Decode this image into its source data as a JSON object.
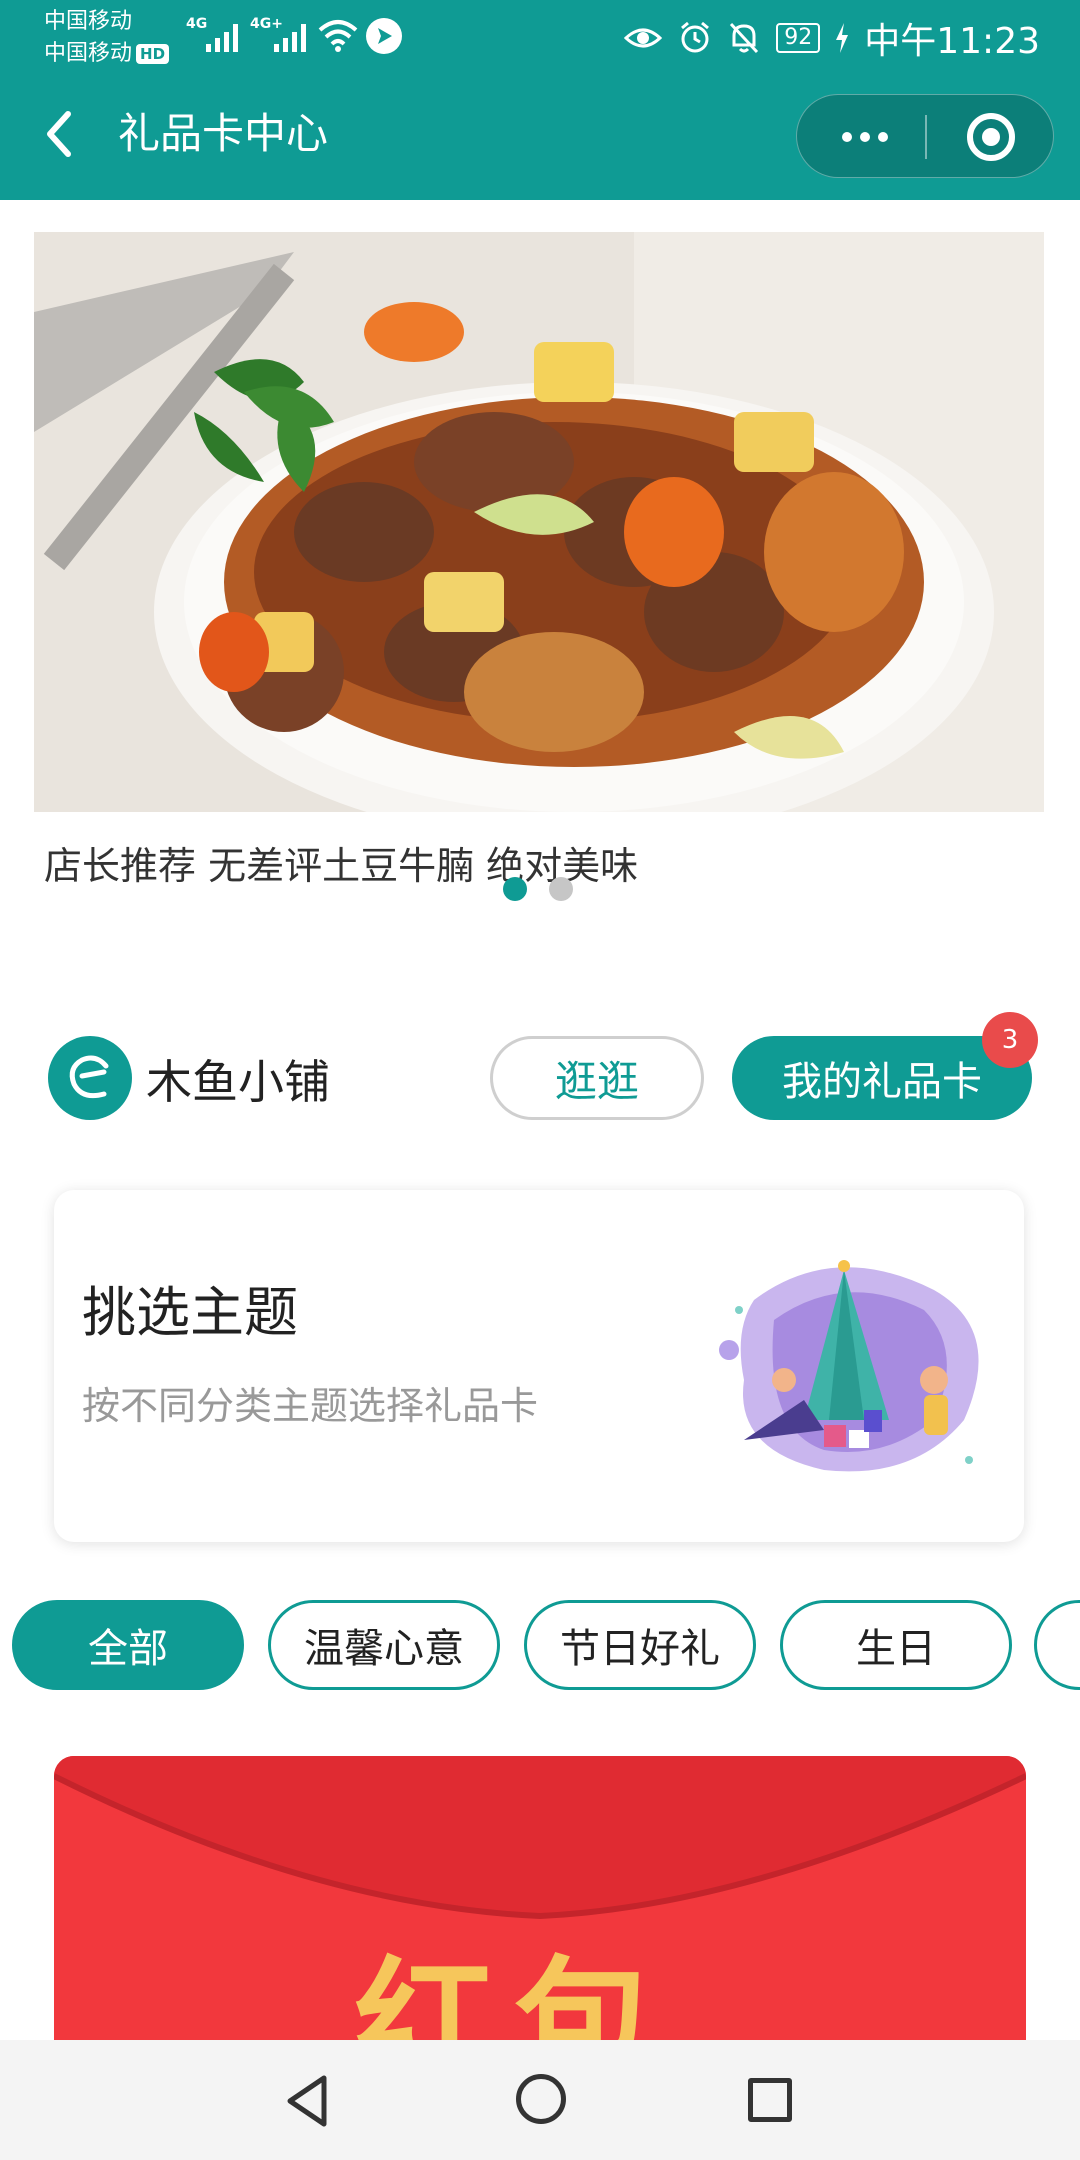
{
  "status_bar": {
    "carrier_1": "中国移动",
    "carrier_2": "中国移动",
    "hd": "HD",
    "signal_1": "4G",
    "signal_2": "4G+",
    "battery": "92",
    "time": "中午11:23"
  },
  "nav": {
    "back_icon": "chevron-left-icon",
    "title": "礼品卡中心",
    "more_icon": "more-dots-icon",
    "close_icon": "target-icon"
  },
  "banner": {
    "caption": "店长推荐 无差评土豆牛腩 绝对美味",
    "slides": 2,
    "active_slide": 1
  },
  "shop": {
    "name": "木鱼小铺",
    "browse_label": "逛逛",
    "my_cards_label": "我的礼品卡",
    "my_cards_count": "3"
  },
  "theme_card": {
    "title": "挑选主题",
    "description": "按不同分类主题选择礼品卡"
  },
  "categories": [
    {
      "label": "全部",
      "active": true
    },
    {
      "label": "温馨心意",
      "active": false
    },
    {
      "label": "节日好礼",
      "active": false
    },
    {
      "label": "生日",
      "active": false
    },
    {
      "label": "",
      "active": false
    }
  ],
  "gift_card": {
    "text": "红包"
  },
  "colors": {
    "primary": "#0f9b94",
    "badge": "#e94b4b",
    "red_card": "#f2383d"
  }
}
